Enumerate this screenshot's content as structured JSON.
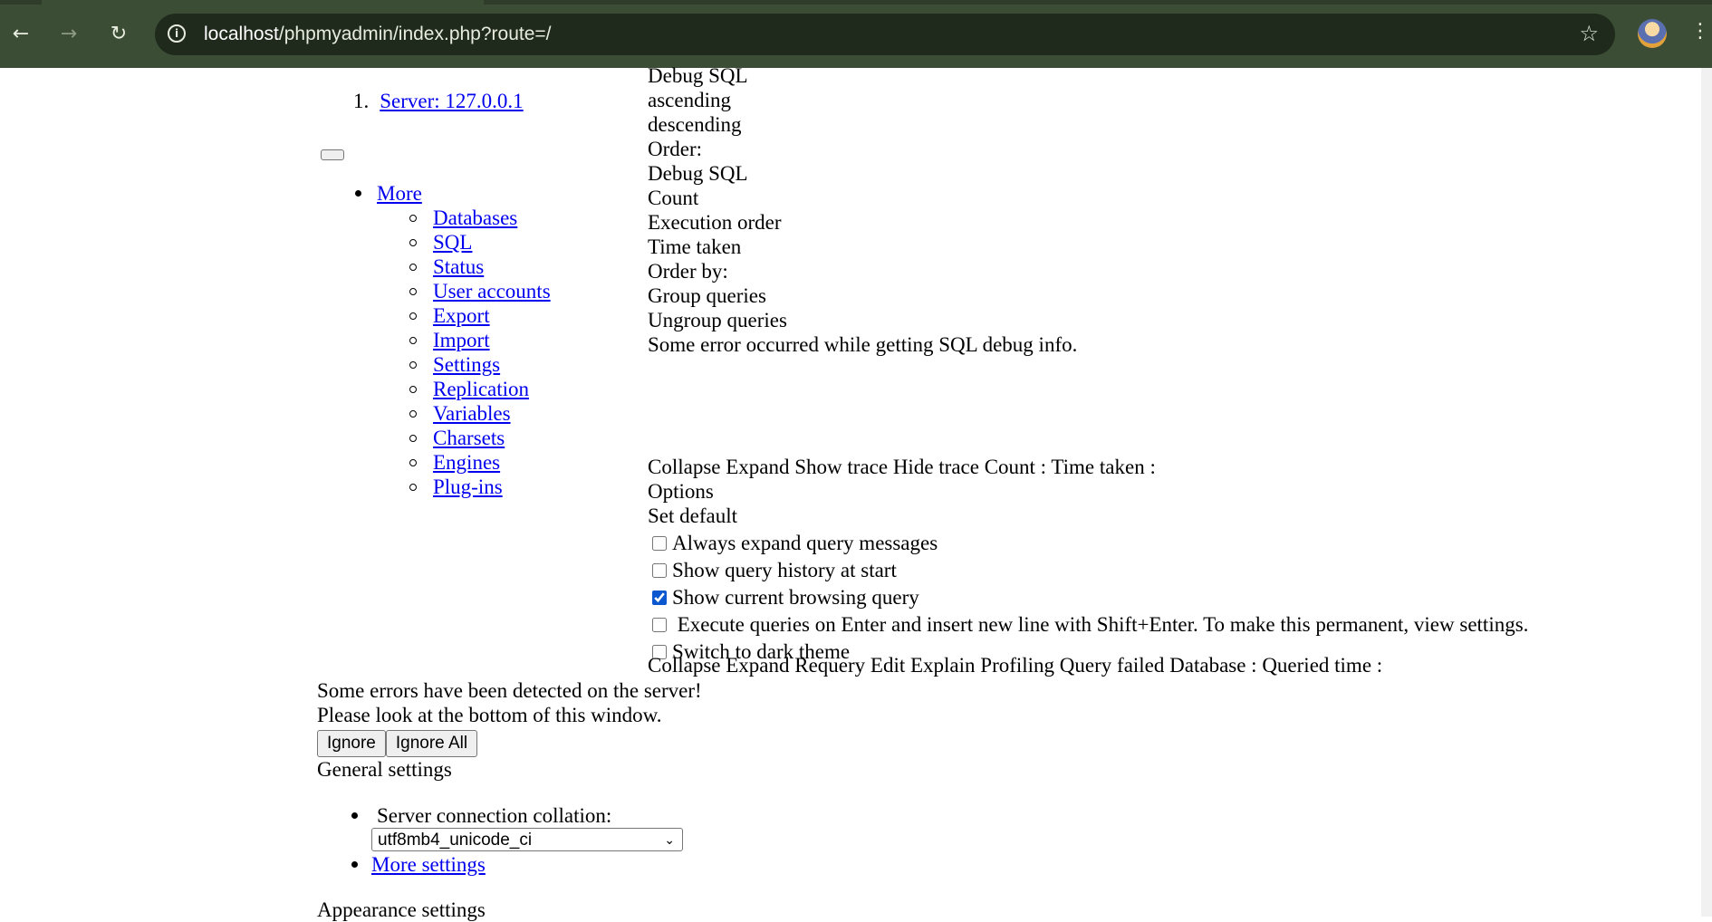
{
  "browser": {
    "url_host": "localhost",
    "url_path": "/phpmyadmin/index.php?route=/",
    "back_icon": "arrow-left",
    "forward_icon": "arrow-right",
    "reload_icon": "reload",
    "star_icon": "star-outline",
    "menu_icon": "vertical-dots"
  },
  "breadcrumb": {
    "number": "1.",
    "server_label": "Server: 127.0.0.1"
  },
  "menu": {
    "more_label": "More",
    "items": [
      " Databases",
      " SQL",
      " Status",
      " User accounts",
      " Export",
      " Import",
      " Settings",
      " Replication",
      " Variables",
      " Charsets",
      " Engines",
      " Plug-ins"
    ]
  },
  "debug": {
    "lines": [
      "Debug SQL",
      "ascending",
      "descending",
      "Order:",
      "Debug SQL",
      "Count",
      "Execution order",
      "Time taken",
      "Order by:",
      "Group queries",
      "Ungroup queries",
      "Some error occurred while getting SQL debug info."
    ],
    "toolbar": "Collapse Expand Show trace Hide trace Count : Time taken :"
  },
  "options": {
    "title": "Options",
    "set_default": "Set default",
    "checkboxes": [
      {
        "label": "Always expand query messages",
        "checked": false
      },
      {
        "label": "Show query history at start",
        "checked": false
      },
      {
        "label": "Show current browsing query",
        "checked": true
      },
      {
        "label": " Execute queries on Enter and insert new line with Shift+Enter. To make this permanent, view settings.",
        "checked": false
      },
      {
        "label": "Switch to dark theme",
        "checked": false
      }
    ],
    "query_bar": "Collapse Expand Requery Edit Explain Profiling Query failed Database : Queried time :"
  },
  "errors": {
    "line1": "Some errors have been detected on the server!",
    "line2": "Please look at the bottom of this window.",
    "ignore": "Ignore",
    "ignore_all": "Ignore All"
  },
  "general": {
    "title": "General settings",
    "collation_label": "Server connection collation:",
    "collation_value": "utf8mb4_unicode_ci",
    "more_settings": " More settings"
  },
  "appearance": {
    "title": "Appearance settings"
  },
  "colors": {
    "chrome_bg": "#3b4d34",
    "omnibox_bg": "#1f2a1c",
    "link": "#0000ee",
    "checkbox_accent": "#0b57d0"
  }
}
